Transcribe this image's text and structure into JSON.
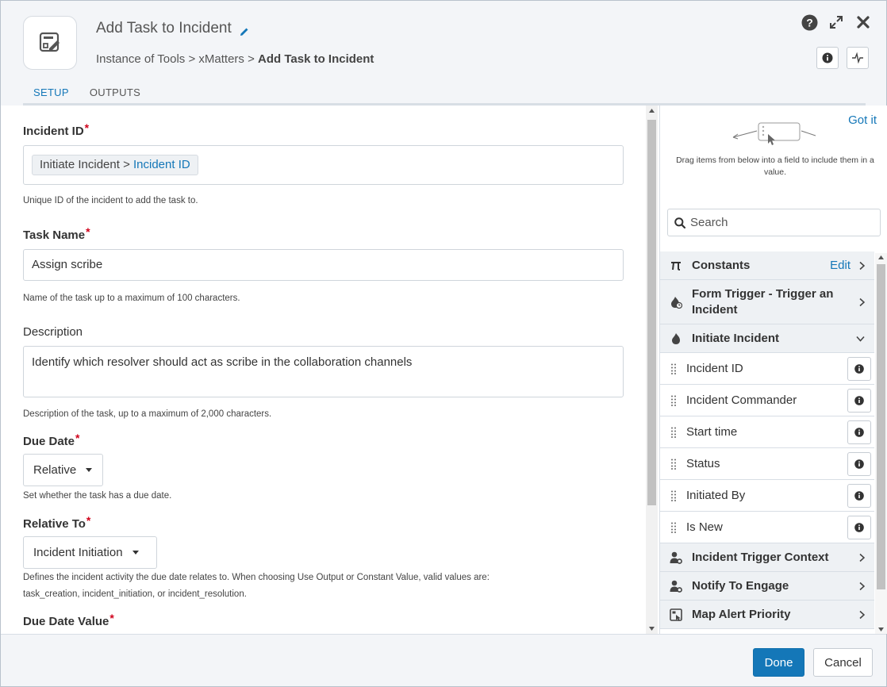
{
  "header": {
    "title": "Add Task to Incident",
    "breadcrumb": {
      "part1": "Instance of Tools",
      "sep": ">",
      "part2": "xMatters",
      "current": "Add Task to Incident"
    },
    "tabs": {
      "setup": "SETUP",
      "outputs": "OUTPUTS"
    }
  },
  "form": {
    "incident_id": {
      "label": "Incident ID",
      "token_prefix": "Initiate Incident >",
      "token_value": "Incident ID",
      "help": "Unique ID of the incident to add the task to."
    },
    "task_name": {
      "label": "Task Name",
      "value": "Assign scribe",
      "help": "Name of the task up to a maximum of 100 characters."
    },
    "description": {
      "label": "Description",
      "value": "Identify which resolver should act as scribe in the collaboration channels",
      "help": "Description of the task, up to a maximum of 2,000 characters."
    },
    "due_date": {
      "label": "Due Date",
      "value": "Relative",
      "help": "Set whether the task has a due date."
    },
    "relative_to": {
      "label": "Relative To",
      "value": "Incident Initiation",
      "help_line1": "Defines the incident activity the due date relates to. When choosing Use Output or Constant Value, valid values are:",
      "help_line2": "task_creation, incident_initiation, or incident_resolution."
    },
    "due_date_value": {
      "label": "Due Date Value"
    },
    "required_mark": "*"
  },
  "panel": {
    "got_it": "Got it",
    "drag_help": "Drag items from below into a field to include them in a value.",
    "search_placeholder": "Search",
    "groups": {
      "constants": {
        "label": "Constants",
        "edit": "Edit"
      },
      "form_trigger": {
        "label_line1": "Form Trigger - Trigger an",
        "label_line2": "Incident"
      },
      "initiate_incident": {
        "label": "Initiate Incident"
      },
      "trigger_context": {
        "label": "Incident Trigger Context"
      },
      "notify": {
        "label": "Notify To Engage"
      },
      "map_priority": {
        "label": "Map Alert Priority"
      }
    },
    "items": [
      "Incident ID",
      "Incident Commander",
      "Start time",
      "Status",
      "Initiated By",
      "Is New"
    ]
  },
  "footer": {
    "done": "Done",
    "cancel": "Cancel"
  },
  "colors": {
    "accent": "#1477b8",
    "required": "#d0021b"
  }
}
